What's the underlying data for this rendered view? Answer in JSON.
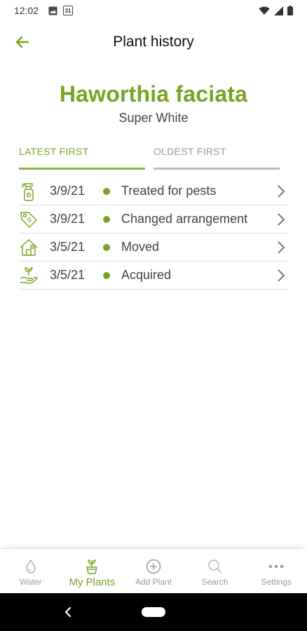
{
  "status_bar": {
    "time": "12:02",
    "calendar_day": "31"
  },
  "header": {
    "title": "Plant history"
  },
  "plant": {
    "name": "Haworthia faciata",
    "variety": "Super White"
  },
  "tabs": [
    {
      "label": "LATEST FIRST",
      "active": true
    },
    {
      "label": "OLDEST FIRST",
      "active": false
    }
  ],
  "history": [
    {
      "date": "3/9/21",
      "event": "Treated for pests",
      "icon": "spray-bottle-icon"
    },
    {
      "date": "3/9/21",
      "event": "Changed arrangement",
      "icon": "tag-icon"
    },
    {
      "date": "3/5/21",
      "event": "Moved",
      "icon": "house-icon"
    },
    {
      "date": "3/5/21",
      "event": "Acquired",
      "icon": "hand-plant-icon"
    }
  ],
  "bottom_nav": [
    {
      "label": "Water",
      "icon": "water-drop-icon",
      "active": false
    },
    {
      "label": "My Plants",
      "icon": "potted-plant-icon",
      "active": true
    },
    {
      "label": "Add Plant",
      "icon": "add-circle-icon",
      "active": false
    },
    {
      "label": "Search",
      "icon": "search-icon",
      "active": false
    },
    {
      "label": "Settings",
      "icon": "more-icon",
      "active": false
    }
  ],
  "colors": {
    "accent": "#7aa322",
    "muted": "#999999",
    "text": "#444444"
  }
}
